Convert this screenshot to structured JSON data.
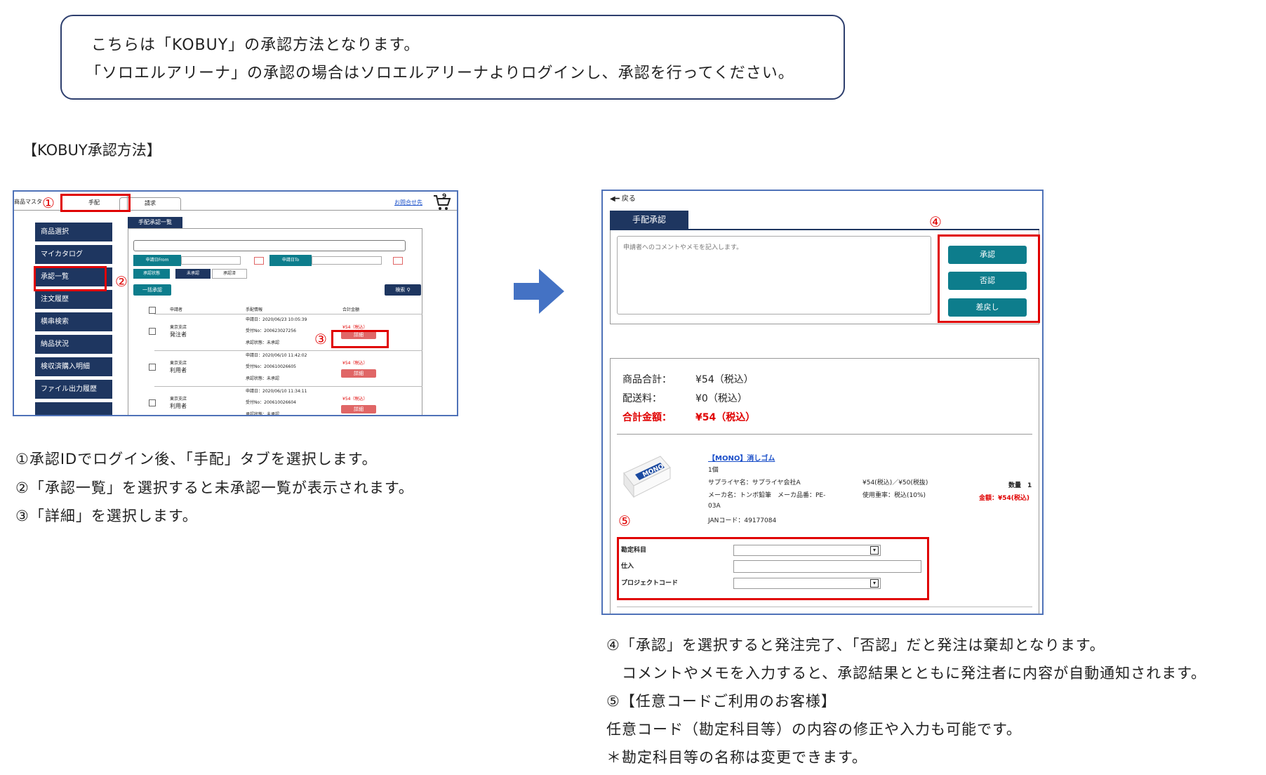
{
  "notice": {
    "line1": "こちらは「KOBUY」の承認方法となります。",
    "line2": "「ソロエルアリーナ」の承認の場合はソロエルアリーナよりログインし、承認を行ってください。"
  },
  "heading": "【KOBUY承認方法】",
  "markers": {
    "m1": "①",
    "m2": "②",
    "m3": "③",
    "m4": "④",
    "m5": "⑤"
  },
  "left_shot": {
    "tab_master": "商品マスタ",
    "tab_arrange": "手配",
    "tab_bill": "請求",
    "inquiry": "お問合せ先",
    "cart_count": "9",
    "sidebar": [
      "商品選択",
      "マイカタログ",
      "承認一覧",
      "注文履歴",
      "横串検索",
      "納品状況",
      "検収済購入明細",
      "ファイル出力履歴"
    ],
    "list_tab": "手配承認一覧",
    "date_from": "申請日From",
    "date_to": "申請日To",
    "status_label": "承認状態",
    "status_unapproved": "未承認",
    "status_approved": "承認済",
    "bulk_button": "一括承認",
    "search_button": "検索",
    "col_applicant": "申請者",
    "col_info": "手配情報",
    "col_total": "合計金額",
    "rows": [
      {
        "org": "東京支店",
        "role": "発注者",
        "date": "申請日：2020/06/23 10:05:39",
        "recv": "受付No：200623027256",
        "status": "承認状態：未承認",
        "price": "¥54（税込）",
        "detail": "詳細"
      },
      {
        "org": "東京支店",
        "role": "利用者",
        "date": "申請日：2020/06/10 11:42:02",
        "recv": "受付No：200610026605",
        "status": "承認状態：未承認",
        "price": "¥54（税込）",
        "detail": "詳細"
      },
      {
        "org": "東京支店",
        "role": "利用者",
        "date": "申請日：2020/06/10 11:34:11",
        "recv": "受付No：200610026604",
        "status": "承認状態：未承認",
        "price": "¥54（税込）",
        "detail": "詳細"
      }
    ]
  },
  "left_desc": [
    "①承認IDでログイン後、「手配」タブを選択します。",
    "②「承認一覧」を選択すると未承認一覧が表示されます。",
    "③「詳細」を選択します。"
  ],
  "right_shot": {
    "back": "戻る",
    "tab": "手配承認",
    "comment_placeholder": "申請者へのコメントやメモを記入します。",
    "btn_approve": "承認",
    "btn_reject": "否認",
    "btn_return": "差戻し",
    "subtotal_label": "商品合計：",
    "subtotal_value": "¥54（税込）",
    "shipping_label": "配送料：",
    "shipping_value": "¥0（税込）",
    "total_label": "合計金額：",
    "total_value": "¥54（税込）",
    "product_name": "【MONO】消しゴム",
    "product_unit": "1個",
    "supplier": "サプライヤ名：サプライヤ会社A",
    "unit_price": "¥54(税込)／¥50(税抜)",
    "maker": "メーカ名：トンボ鉛筆　メーカ品番：PE-",
    "maker_cont": "03A",
    "tax": "使用重率：税込(10%)",
    "jan": "JANコード：49177084",
    "qty": "数量　1",
    "amount": "金額：¥54(税込)",
    "field_account": "勘定科目",
    "field_purchase": "仕入",
    "field_project": "プロジェクトコード",
    "brand": "MONO"
  },
  "right_desc": [
    "④「承認」を選択すると発注完了、「否認」だと発注は棄却となります。",
    "　コメントやメモを入力すると、承認結果とともに発注者に内容が自動通知されます。",
    "⑤【任意コードご利用のお客様】",
    "任意コード（勘定科目等）の内容の修正や入力も可能です。",
    "＊勘定科目等の名称は変更できます。"
  ],
  "colors": {
    "accent_red": "#e00000",
    "teal": "#0d7d8c",
    "navy": "#1e3660",
    "arrow_blue": "#4472c4"
  }
}
